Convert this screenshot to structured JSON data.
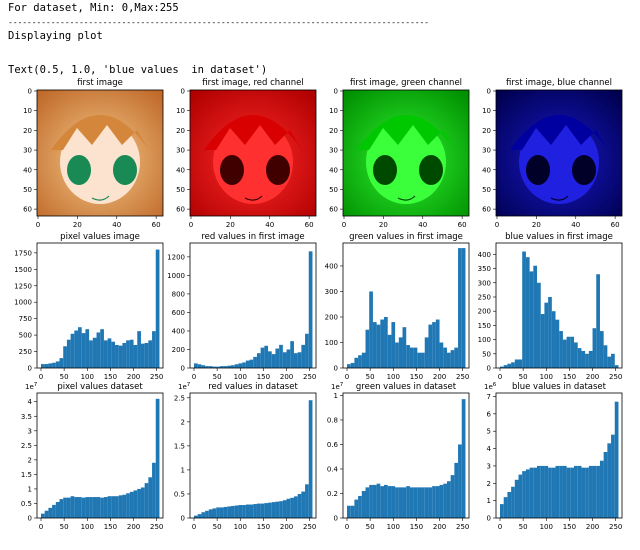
{
  "console": {
    "line1": "For dataset, Min: 0,Max:255",
    "separator": "-----------------------------------------------------------------------------------------",
    "line3": "Displaying plot",
    "line4": "Text(0.5, 1.0, 'blue values  in dataset')"
  },
  "image_panels": [
    {
      "title": "first image",
      "tint": "full",
      "ylabels": [
        "0",
        "10",
        "20",
        "30",
        "40",
        "50",
        "60"
      ],
      "xlabels": [
        "0",
        "20",
        "40",
        "60"
      ]
    },
    {
      "title": "first image, red channel",
      "tint": "#ff0000",
      "ylabels": [
        "0",
        "10",
        "20",
        "30",
        "40",
        "50",
        "60"
      ],
      "xlabels": [
        "0",
        "20",
        "40",
        "60"
      ]
    },
    {
      "title": "first image, green channel",
      "tint": "#00ff00",
      "ylabels": [
        "0",
        "10",
        "20",
        "30",
        "40",
        "50",
        "60"
      ],
      "xlabels": [
        "0",
        "20",
        "40",
        "60"
      ]
    },
    {
      "title": "first image, blue channel",
      "tint": "#0000ff",
      "ylabels": [
        "0",
        "10",
        "20",
        "30",
        "40",
        "50",
        "60"
      ],
      "xlabels": [
        "0",
        "20",
        "40",
        "60"
      ]
    }
  ],
  "colors": {
    "bar": "#1f77b4"
  },
  "chart_data": [
    {
      "type": "bar",
      "title": "pixel values image",
      "xlim": [
        0,
        255
      ],
      "ylim": [
        0,
        1900
      ],
      "yticks": [
        0,
        250,
        500,
        750,
        1000,
        1250,
        1500,
        1750
      ],
      "xticks": [
        0,
        50,
        100,
        150,
        200,
        250
      ],
      "scale": "",
      "values": [
        60,
        60,
        70,
        80,
        100,
        150,
        330,
        430,
        520,
        570,
        620,
        530,
        590,
        420,
        460,
        540,
        590,
        420,
        450,
        400,
        350,
        340,
        380,
        420,
        430,
        350,
        560,
        370,
        380,
        420,
        560,
        1800
      ]
    },
    {
      "type": "bar",
      "title": "red values  in first image",
      "xlim": [
        0,
        255
      ],
      "ylim": [
        0,
        1350
      ],
      "yticks": [
        0,
        200,
        400,
        600,
        800,
        1000,
        1200
      ],
      "xticks": [
        0,
        50,
        100,
        150,
        200,
        250
      ],
      "scale": "",
      "values": [
        50,
        40,
        30,
        20,
        20,
        15,
        15,
        20,
        20,
        25,
        30,
        40,
        50,
        60,
        80,
        90,
        120,
        160,
        220,
        240,
        180,
        150,
        210,
        250,
        170,
        200,
        290,
        160,
        170,
        250,
        370,
        1260
      ]
    },
    {
      "type": "bar",
      "title": "green values  in first image",
      "xlim": [
        0,
        255
      ],
      "ylim": [
        0,
        490
      ],
      "yticks": [
        0,
        100,
        200,
        300,
        400
      ],
      "xticks": [
        0,
        50,
        100,
        150,
        200,
        250
      ],
      "scale": "",
      "values": [
        15,
        20,
        40,
        50,
        60,
        150,
        300,
        180,
        170,
        190,
        200,
        130,
        180,
        100,
        120,
        160,
        90,
        80,
        80,
        60,
        60,
        120,
        170,
        180,
        190,
        100,
        80,
        60,
        70,
        80,
        470,
        470
      ]
    },
    {
      "type": "bar",
      "title": "blue values  in first image",
      "xlim": [
        0,
        255
      ],
      "ylim": [
        0,
        440
      ],
      "yticks": [
        0,
        50,
        100,
        150,
        200,
        250,
        300,
        350,
        400
      ],
      "xticks": [
        0,
        50,
        100,
        150,
        200,
        250
      ],
      "scale": "",
      "values": [
        5,
        10,
        15,
        20,
        30,
        30,
        410,
        390,
        340,
        360,
        300,
        190,
        230,
        250,
        200,
        170,
        130,
        100,
        110,
        110,
        90,
        70,
        60,
        50,
        60,
        140,
        330,
        130,
        80,
        40,
        50,
        10
      ]
    },
    {
      "type": "bar",
      "title": "pixel values dataset",
      "xlim": [
        0,
        255
      ],
      "ylim": [
        0,
        4.3
      ],
      "yticks": [
        0,
        0.5,
        1.0,
        1.5,
        2.0,
        2.5,
        3.0,
        3.5,
        4.0
      ],
      "xticks": [
        0,
        50,
        100,
        150,
        200,
        250
      ],
      "scale": "1e7",
      "values": [
        0.15,
        0.25,
        0.35,
        0.45,
        0.55,
        0.65,
        0.7,
        0.7,
        0.75,
        0.72,
        0.72,
        0.7,
        0.72,
        0.72,
        0.72,
        0.72,
        0.7,
        0.72,
        0.75,
        0.75,
        0.75,
        0.78,
        0.8,
        0.85,
        0.9,
        0.95,
        1.0,
        1.05,
        1.2,
        1.4,
        1.9,
        4.1
      ]
    },
    {
      "type": "bar",
      "title": "red values  in dataset",
      "xlim": [
        0,
        255
      ],
      "ylim": [
        0,
        2.6
      ],
      "yticks": [
        0,
        0.5,
        1.0,
        1.5,
        2.0,
        2.5
      ],
      "xticks": [
        0,
        50,
        100,
        150,
        200,
        250
      ],
      "scale": "1e7",
      "values": [
        0.05,
        0.08,
        0.12,
        0.15,
        0.18,
        0.2,
        0.22,
        0.22,
        0.23,
        0.24,
        0.25,
        0.26,
        0.27,
        0.27,
        0.28,
        0.28,
        0.29,
        0.3,
        0.3,
        0.31,
        0.32,
        0.33,
        0.34,
        0.35,
        0.37,
        0.4,
        0.42,
        0.45,
        0.5,
        0.55,
        0.7,
        2.45
      ]
    },
    {
      "type": "bar",
      "title": "green values  in dataset",
      "xlim": [
        0,
        255
      ],
      "ylim": [
        0,
        1.02
      ],
      "yticks": [
        0,
        0.2,
        0.4,
        0.6,
        0.8,
        1.0
      ],
      "xticks": [
        0,
        50,
        100,
        150,
        200,
        250
      ],
      "scale": "1e7",
      "values": [
        0.1,
        0.1,
        0.15,
        0.18,
        0.22,
        0.25,
        0.27,
        0.27,
        0.28,
        0.26,
        0.27,
        0.26,
        0.26,
        0.25,
        0.25,
        0.25,
        0.26,
        0.25,
        0.25,
        0.25,
        0.25,
        0.25,
        0.25,
        0.26,
        0.26,
        0.27,
        0.28,
        0.3,
        0.35,
        0.45,
        0.6,
        0.97
      ]
    },
    {
      "type": "bar",
      "title": "blue values  in dataset",
      "xlim": [
        0,
        255
      ],
      "ylim": [
        0,
        7.2
      ],
      "yticks": [
        0,
        1,
        2,
        3,
        4,
        5,
        6,
        7
      ],
      "xticks": [
        0,
        50,
        100,
        150,
        200,
        250
      ],
      "scale": "1e6",
      "values": [
        0.8,
        1.2,
        1.5,
        1.8,
        2.2,
        2.5,
        2.7,
        2.8,
        2.9,
        2.9,
        3.0,
        3.0,
        3.0,
        2.9,
        2.9,
        3.0,
        3.0,
        3.0,
        2.9,
        2.9,
        3.0,
        3.0,
        2.9,
        2.9,
        3.0,
        3.0,
        3.0,
        3.3,
        3.8,
        4.3,
        4.8,
        6.7
      ]
    }
  ]
}
